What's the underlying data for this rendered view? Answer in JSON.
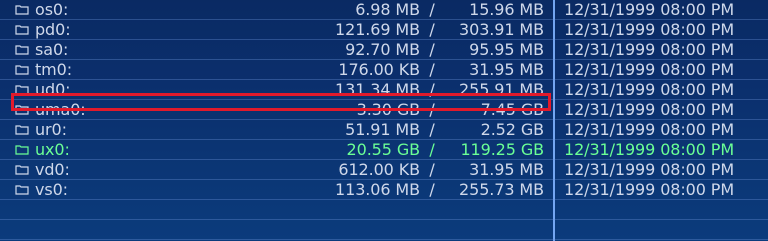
{
  "file_list": {
    "rows": [
      {
        "name": "os0:",
        "used": "6.98 MB",
        "separator": "/",
        "total": "15.96 MB",
        "date": "12/31/1999 08:00 PM"
      },
      {
        "name": "pd0:",
        "used": "121.69 MB",
        "separator": "/",
        "total": "303.91 MB",
        "date": "12/31/1999 08:00 PM"
      },
      {
        "name": "sa0:",
        "used": "92.70 MB",
        "separator": "/",
        "total": "95.95 MB",
        "date": "12/31/1999 08:00 PM"
      },
      {
        "name": "tm0:",
        "used": "176.00 KB",
        "separator": "/",
        "total": "31.95 MB",
        "date": "12/31/1999 08:00 PM"
      },
      {
        "name": "ud0:",
        "used": "131.34 MB",
        "separator": "/",
        "total": "255.91 MB",
        "date": "12/31/1999 08:00 PM"
      },
      {
        "name": "uma0:",
        "used": "3.30 GB",
        "separator": "/",
        "total": "7.45 GB",
        "date": "12/31/1999 08:00 PM"
      },
      {
        "name": "ur0:",
        "used": "51.91 MB",
        "separator": "/",
        "total": "2.52 GB",
        "date": "12/31/1999 08:00 PM"
      },
      {
        "name": "ux0:",
        "used": "20.55 GB",
        "separator": "/",
        "total": "119.25 GB",
        "date": "12/31/1999 08:00 PM"
      },
      {
        "name": "vd0:",
        "used": "612.00 KB",
        "separator": "/",
        "total": "31.95 MB",
        "date": "12/31/1999 08:00 PM"
      },
      {
        "name": "vs0:",
        "used": "113.06 MB",
        "separator": "/",
        "total": "255.73 MB",
        "date": "12/31/1999 08:00 PM"
      }
    ],
    "active_row": "ux0:",
    "highlighted_row": "uma0:",
    "colors": {
      "text": "#cfd8ea",
      "active_text": "#6bff95",
      "highlight_border": "#e21a2b",
      "background": "#0b2f6d",
      "divider": "#7fb3ff"
    },
    "icon": "folder-icon"
  }
}
